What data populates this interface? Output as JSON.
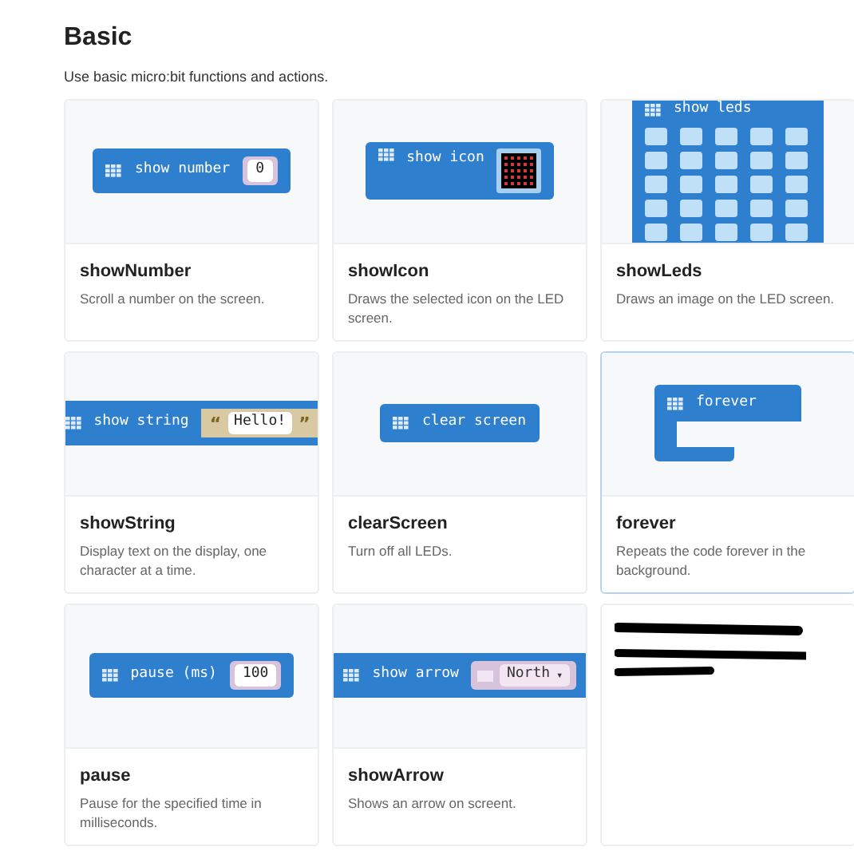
{
  "title": "Basic",
  "subtitle": "Use basic micro:bit functions and actions.",
  "cards": [
    {
      "kind": "number",
      "label": "show number",
      "value": "0",
      "name": "showNumber",
      "description": "Scroll a number on the screen.",
      "selected": false
    },
    {
      "kind": "icon",
      "label": "show icon",
      "name": "showIcon",
      "description": "Draws the selected icon on the LED screen.",
      "selected": false
    },
    {
      "kind": "leds",
      "label": "show leds",
      "name": "showLeds",
      "description": "Draws an image on the LED screen.",
      "selected": false
    },
    {
      "kind": "string",
      "label": "show string",
      "value": "Hello!",
      "open_quote": "“",
      "close_quote": "”",
      "name": "showString",
      "description": "Display text on the display, one character at a time.",
      "selected": false
    },
    {
      "kind": "plain",
      "label": "clear screen",
      "name": "clearScreen",
      "description": "Turn off all LEDs.",
      "selected": false
    },
    {
      "kind": "forever",
      "label": "forever",
      "name": "forever",
      "description": "Repeats the code forever in the background.",
      "selected": true
    },
    {
      "kind": "number",
      "label": "pause (ms)",
      "value": "100",
      "name": "pause",
      "description": "Pause for the specified time in milliseconds.",
      "selected": false
    },
    {
      "kind": "dropdown",
      "label": "show arrow",
      "value": "North",
      "caret": "▾",
      "name": "showArrow",
      "description": "Shows an arrow on screent.",
      "selected": false
    },
    {
      "kind": "redacted",
      "selected": false
    }
  ]
}
